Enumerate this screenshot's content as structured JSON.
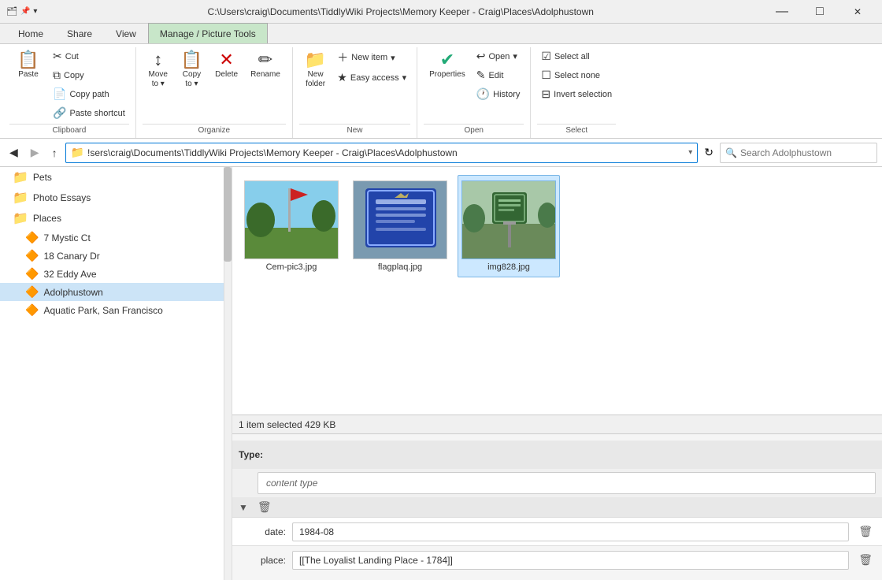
{
  "title_bar": {
    "path": "C:\\Users\\craig\\Documents\\TiddlyWiki Projects\\Memory Keeper - Craig\\Places\\Adolphustown",
    "app_icon": "🗂",
    "controls": [
      "—",
      "□",
      "✕"
    ]
  },
  "ribbon_tabs": [
    {
      "label": "Home",
      "active": true
    },
    {
      "label": "Share"
    },
    {
      "label": "View"
    },
    {
      "label": "Picture Tools",
      "highlighted": true,
      "sublabel": "Manage"
    }
  ],
  "clipboard_group": {
    "label": "Clipboard",
    "paste_label": "Paste",
    "cut_label": "Cut",
    "copy_label": "Copy",
    "copy_path_label": "Copy path",
    "paste_shortcut_label": "Paste shortcut"
  },
  "organize_group": {
    "label": "Organize",
    "move_to_label": "Move\nto",
    "copy_to_label": "Copy\nto",
    "delete_label": "Delete",
    "rename_label": "Rename"
  },
  "new_group": {
    "label": "New",
    "new_item_label": "New item",
    "easy_access_label": "Easy access",
    "new_folder_label": "New\nfolder"
  },
  "open_group": {
    "label": "Open",
    "properties_label": "Properties",
    "open_label": "Open",
    "edit_label": "Edit",
    "history_label": "History"
  },
  "select_group": {
    "label": "Select",
    "select_all_label": "Select all",
    "select_none_label": "Select none",
    "invert_selection_label": "Invert selection"
  },
  "address_bar": {
    "path": "!sers\\craig\\Documents\\TiddlyWiki Projects\\Memory Keeper - Craig\\Places\\Adolphustown",
    "search_placeholder": "Search Adolphustown"
  },
  "sidebar": {
    "items": [
      {
        "label": "Pets",
        "level": 0
      },
      {
        "label": "Photo Essays",
        "level": 0
      },
      {
        "label": "Places",
        "level": 0
      },
      {
        "label": "7 Mystic Ct",
        "level": 1
      },
      {
        "label": "18 Canary Dr",
        "level": 1
      },
      {
        "label": "32 Eddy Ave",
        "level": 1
      },
      {
        "label": "Adolphustown",
        "level": 1,
        "active": true
      },
      {
        "label": "Aquatic Park, San Francisco",
        "level": 1
      }
    ]
  },
  "files": [
    {
      "name": "Cem-pic3.jpg",
      "selected": false,
      "thumb_color": "#7a9e6a"
    },
    {
      "name": "flagplaq.jpg",
      "selected": false,
      "thumb_color": "#3a5a8a"
    },
    {
      "name": "img828.jpg",
      "selected": true,
      "thumb_color": "#5a7a4a"
    }
  ],
  "status_bar": {
    "text": "1 item selected  429 KB"
  },
  "bottom_panel": {
    "type_label": "Type:",
    "content_type_placeholder": "content type",
    "collapse_icon": "▼",
    "delete_icon": "🗑",
    "fields": [
      {
        "label": "date:",
        "value": "1984-08"
      },
      {
        "label": "place:",
        "value": "[[The Loyalist Landing Place - 1784]]"
      }
    ]
  }
}
